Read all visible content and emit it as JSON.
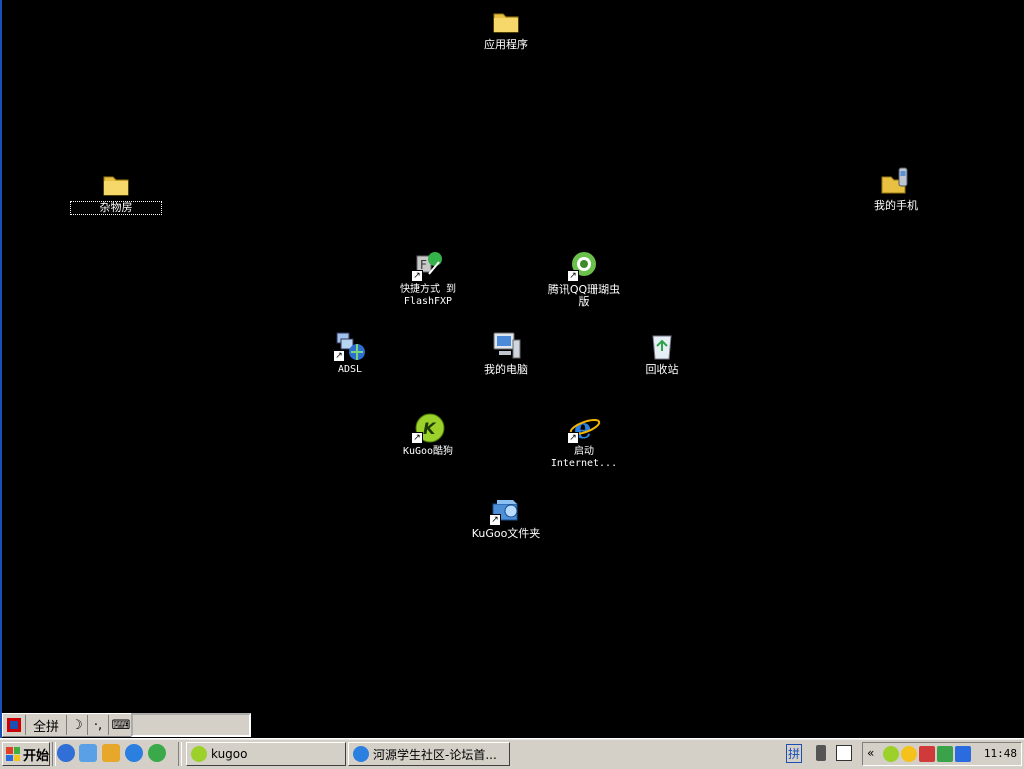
{
  "desktop": {
    "icons": [
      {
        "label": "应用程序"
      },
      {
        "label": "杂物房"
      },
      {
        "label": "我的手机"
      },
      {
        "label": "快捷方式 到\nFlashFXP"
      },
      {
        "label": "腾讯QQ珊瑚虫\n版"
      },
      {
        "label": "ADSL"
      },
      {
        "label": "我的电脑"
      },
      {
        "label": "回收站"
      },
      {
        "label": "KuGoo酷狗"
      },
      {
        "label": "启动\nInternet..."
      },
      {
        "label": "KuGoo文件夹"
      }
    ]
  },
  "ime": {
    "mode_label": "全拼",
    "moon": "☽",
    "punct": "·,",
    "keyboard": "⌨"
  },
  "taskbar": {
    "start_label": "开始",
    "tasks": [
      {
        "label": "kugoo"
      },
      {
        "label": "河源学生社区-论坛首..."
      }
    ],
    "tray": {
      "ime_indicator": "拼",
      "chevron": "«",
      "clock": "11:48"
    }
  },
  "colors": {
    "desktop_bg": "#000000",
    "taskbar_bg": "#d4d0c8"
  }
}
